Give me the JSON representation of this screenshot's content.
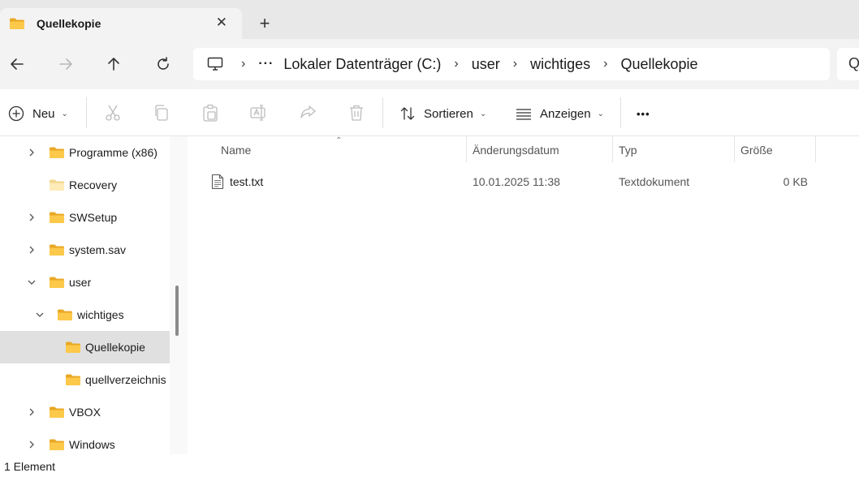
{
  "tab": {
    "title": "Quellekopie",
    "close": "✕",
    "new_tab": "+"
  },
  "address": {
    "overflow": "···",
    "crumbs": [
      "Lokaler Datenträger (C:)",
      "user",
      "wichtiges",
      "Quellekopie"
    ],
    "search_glyph": "Q"
  },
  "toolbar": {
    "new_label": "Neu",
    "sort_label": "Sortieren",
    "view_label": "Anzeigen",
    "more": "•••"
  },
  "nav": {
    "items": [
      {
        "label": "Programme (x86)",
        "expand": "collapsed"
      },
      {
        "label": "Recovery",
        "expand": "none"
      },
      {
        "label": "SWSetup",
        "expand": "collapsed"
      },
      {
        "label": "system.sav",
        "expand": "collapsed"
      },
      {
        "label": "user",
        "expand": "expanded"
      },
      {
        "label": "wichtiges",
        "expand": "expanded"
      },
      {
        "label": "Quellekopie",
        "expand": "none",
        "selected": true
      },
      {
        "label": "quellverzeichnis",
        "expand": "none"
      },
      {
        "label": "VBOX",
        "expand": "collapsed"
      },
      {
        "label": "Windows",
        "expand": "collapsed"
      }
    ]
  },
  "table": {
    "columns": [
      "Name",
      "Änderungsdatum",
      "Typ",
      "Größe"
    ],
    "rows": [
      {
        "name": "test.txt",
        "modified": "10.01.2025 11:38",
        "type": "Textdokument",
        "size": "0 KB"
      }
    ]
  },
  "status": {
    "text": "1 Element"
  },
  "colors": {
    "folder": "#f8c245",
    "folder_light": "#fde9b3",
    "selected": "#e0e0e0",
    "accent": "#0067c0"
  }
}
